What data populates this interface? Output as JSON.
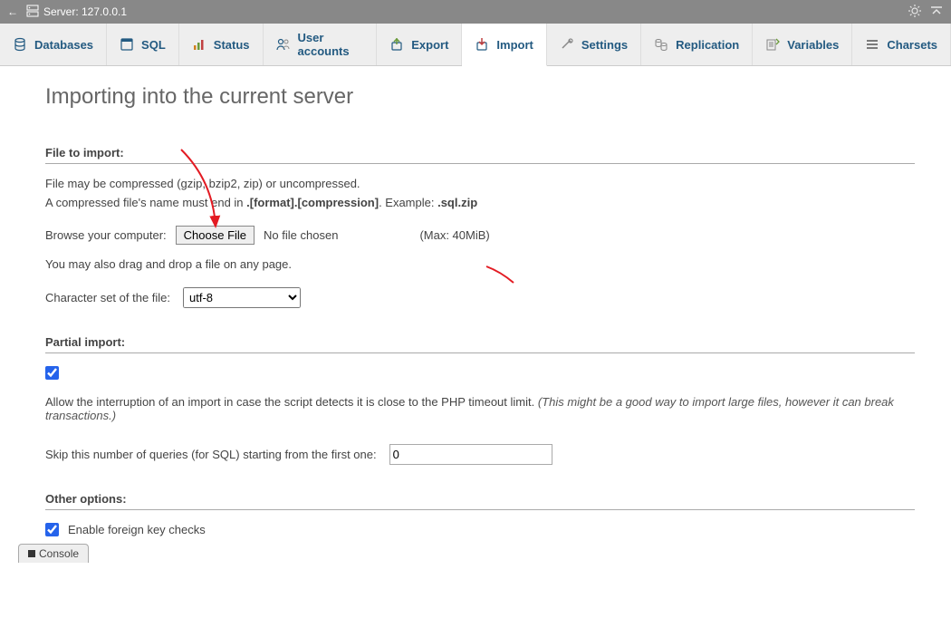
{
  "topbar": {
    "server_text": "Server: 127.0.0.1"
  },
  "tabs": [
    {
      "id": "databases",
      "label": "Databases",
      "active": false
    },
    {
      "id": "sql",
      "label": "SQL",
      "active": false
    },
    {
      "id": "status",
      "label": "Status",
      "active": false
    },
    {
      "id": "user-accounts",
      "label": "User accounts",
      "active": false
    },
    {
      "id": "export",
      "label": "Export",
      "active": false
    },
    {
      "id": "import",
      "label": "Import",
      "active": true
    },
    {
      "id": "settings",
      "label": "Settings",
      "active": false
    },
    {
      "id": "replication",
      "label": "Replication",
      "active": false
    },
    {
      "id": "variables",
      "label": "Variables",
      "active": false
    },
    {
      "id": "charsets",
      "label": "Charsets",
      "active": false
    }
  ],
  "page": {
    "title": "Importing into the current server"
  },
  "file_import": {
    "title": "File to import:",
    "line1": "File may be compressed (gzip, bzip2, zip) or uncompressed.",
    "line2_pre": "A compressed file's name must end in ",
    "line2_bold": ".[format].[compression]",
    "line2_mid": ". Example: ",
    "line2_example": ".sql.zip",
    "browse_label": "Browse your computer:",
    "choose_file_label": "Choose File",
    "no_file_text": "No file chosen",
    "max_text": "(Max: 40MiB)",
    "drag_text": "You may also drag and drop a file on any page.",
    "charset_label": "Character set of the file:",
    "charset_value": "utf-8"
  },
  "partial": {
    "title": "Partial import:",
    "allow_checked": true,
    "desc_plain": "Allow the interruption of an import in case the script detects it is close to the PHP timeout limit. ",
    "desc_italic": "(This might be a good way to import large files, however it can break transactions.)",
    "skip_label": "Skip this number of queries (for SQL) starting from the first one:",
    "skip_value": "0"
  },
  "other": {
    "title": "Other options:",
    "fk_checked": true,
    "fk_label": "Enable foreign key checks"
  },
  "console": {
    "label": "Console"
  }
}
